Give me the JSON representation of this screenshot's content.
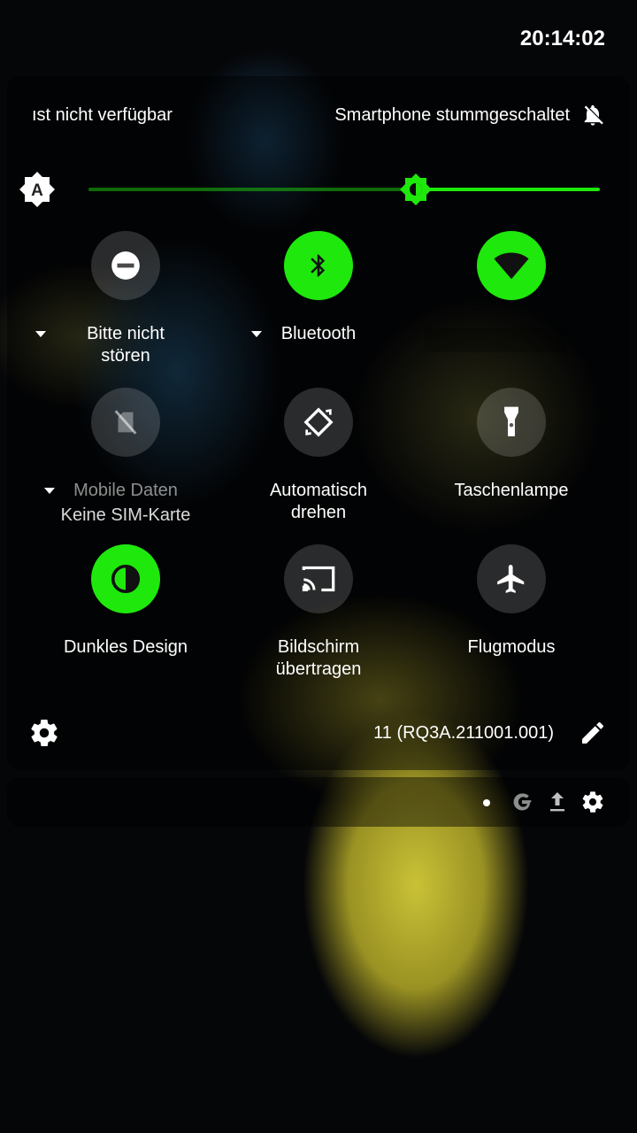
{
  "status_bar": {
    "time": "20:14:02"
  },
  "header": {
    "left_text": "ıst nicht verfügbar",
    "right_text": "Smartphone stummgeschaltet",
    "right_icon": "bell-off-icon"
  },
  "brightness": {
    "level_fraction": 0.64,
    "auto_label": "A",
    "accent": "#1fe80c"
  },
  "tiles": [
    {
      "label": "Bitte nicht stören",
      "state": "off",
      "icon": "do-not-disturb-icon",
      "has_dropdown": true
    },
    {
      "label": "Bluetooth",
      "state": "on",
      "icon": "bluetooth-icon",
      "has_dropdown": true
    },
    {
      "label": "",
      "state": "on",
      "icon": "wifi-icon",
      "has_dropdown": false
    },
    {
      "label": "Mobile Daten",
      "sublabel": "Keine SIM-Karte",
      "state": "unavailable",
      "icon": "no-sim-icon",
      "has_dropdown": true
    },
    {
      "label": "Automatisch drehen",
      "state": "off",
      "icon": "auto-rotate-icon",
      "has_dropdown": false
    },
    {
      "label": "Taschenlampe",
      "state": "off",
      "icon": "flashlight-icon",
      "has_dropdown": false
    },
    {
      "label": "Dunkles Design",
      "state": "on",
      "icon": "dark-theme-icon",
      "has_dropdown": false
    },
    {
      "label": "Bildschirm übertragen",
      "state": "off",
      "icon": "cast-icon",
      "has_dropdown": false
    },
    {
      "label": "Flugmodus",
      "state": "off",
      "icon": "airplane-icon",
      "has_dropdown": false
    }
  ],
  "footer": {
    "build": "11 (RQ3A.211001.001)"
  },
  "notifications": {
    "icons": [
      "dot-icon",
      "google-icon",
      "upload-icon",
      "settings-icon"
    ]
  },
  "colors": {
    "accent": "#1fe80c",
    "tile_off": "rgba(255,255,255,0.16)"
  }
}
